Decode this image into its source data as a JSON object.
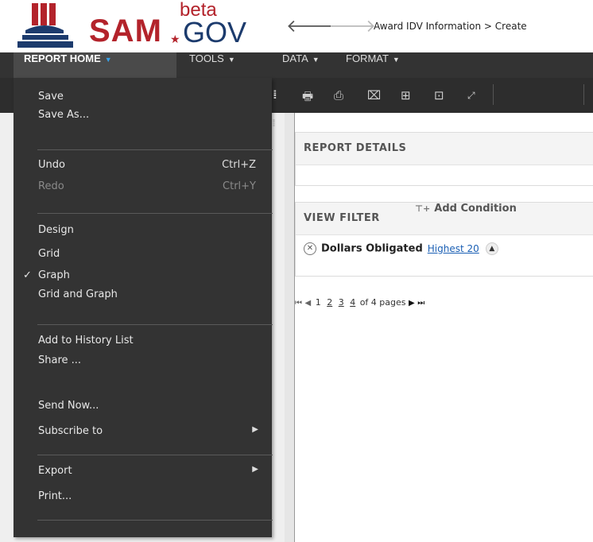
{
  "app": {
    "logo_main": "SAM",
    "logo_beta": "beta",
    "logo_gov": "GOV",
    "breadcrumb": "Award IDV Information > Create"
  },
  "menubar": {
    "items": [
      {
        "label": "REPORT HOME",
        "active": true
      },
      {
        "label": "TOOLS",
        "active": false
      },
      {
        "label": "DATA",
        "active": false
      },
      {
        "label": "FORMAT",
        "active": false
      }
    ]
  },
  "dropdown": {
    "save": "Save",
    "save_as": "Save As...",
    "undo": "Undo",
    "undo_shortcut": "Ctrl+Z",
    "redo": "Redo",
    "redo_shortcut": "Ctrl+Y",
    "design": "Design",
    "grid": "Grid",
    "graph": "Graph",
    "grid_and_graph": "Grid and Graph",
    "add_history": "Add to History List",
    "share": "Share ...",
    "send_now": "Send Now...",
    "subscribe": "Subscribe to",
    "export": "Export",
    "print": "Print..."
  },
  "content": {
    "report_details": "REPORT DETAILS",
    "view_filter": "VIEW FILTER",
    "add_condition": "Add Condition",
    "filter_name": "Dollars Obligated",
    "filter_value": "Highest 20"
  },
  "pager": {
    "pages": [
      "1",
      "2",
      "3",
      "4"
    ],
    "suffix": "of 4 pages"
  },
  "colors": {
    "menubar_bg": "#333333",
    "logo_red": "#b3232b",
    "logo_blue": "#1c3b6d",
    "accent_blue": "#36a2eb",
    "link_blue": "#1a5fb4"
  },
  "icons": {
    "back": "arrow-left-icon",
    "forward": "arrow-right-icon",
    "checked": "check-icon",
    "submenu": "chevron-right-icon",
    "remove_filter": "close-circle-icon"
  }
}
